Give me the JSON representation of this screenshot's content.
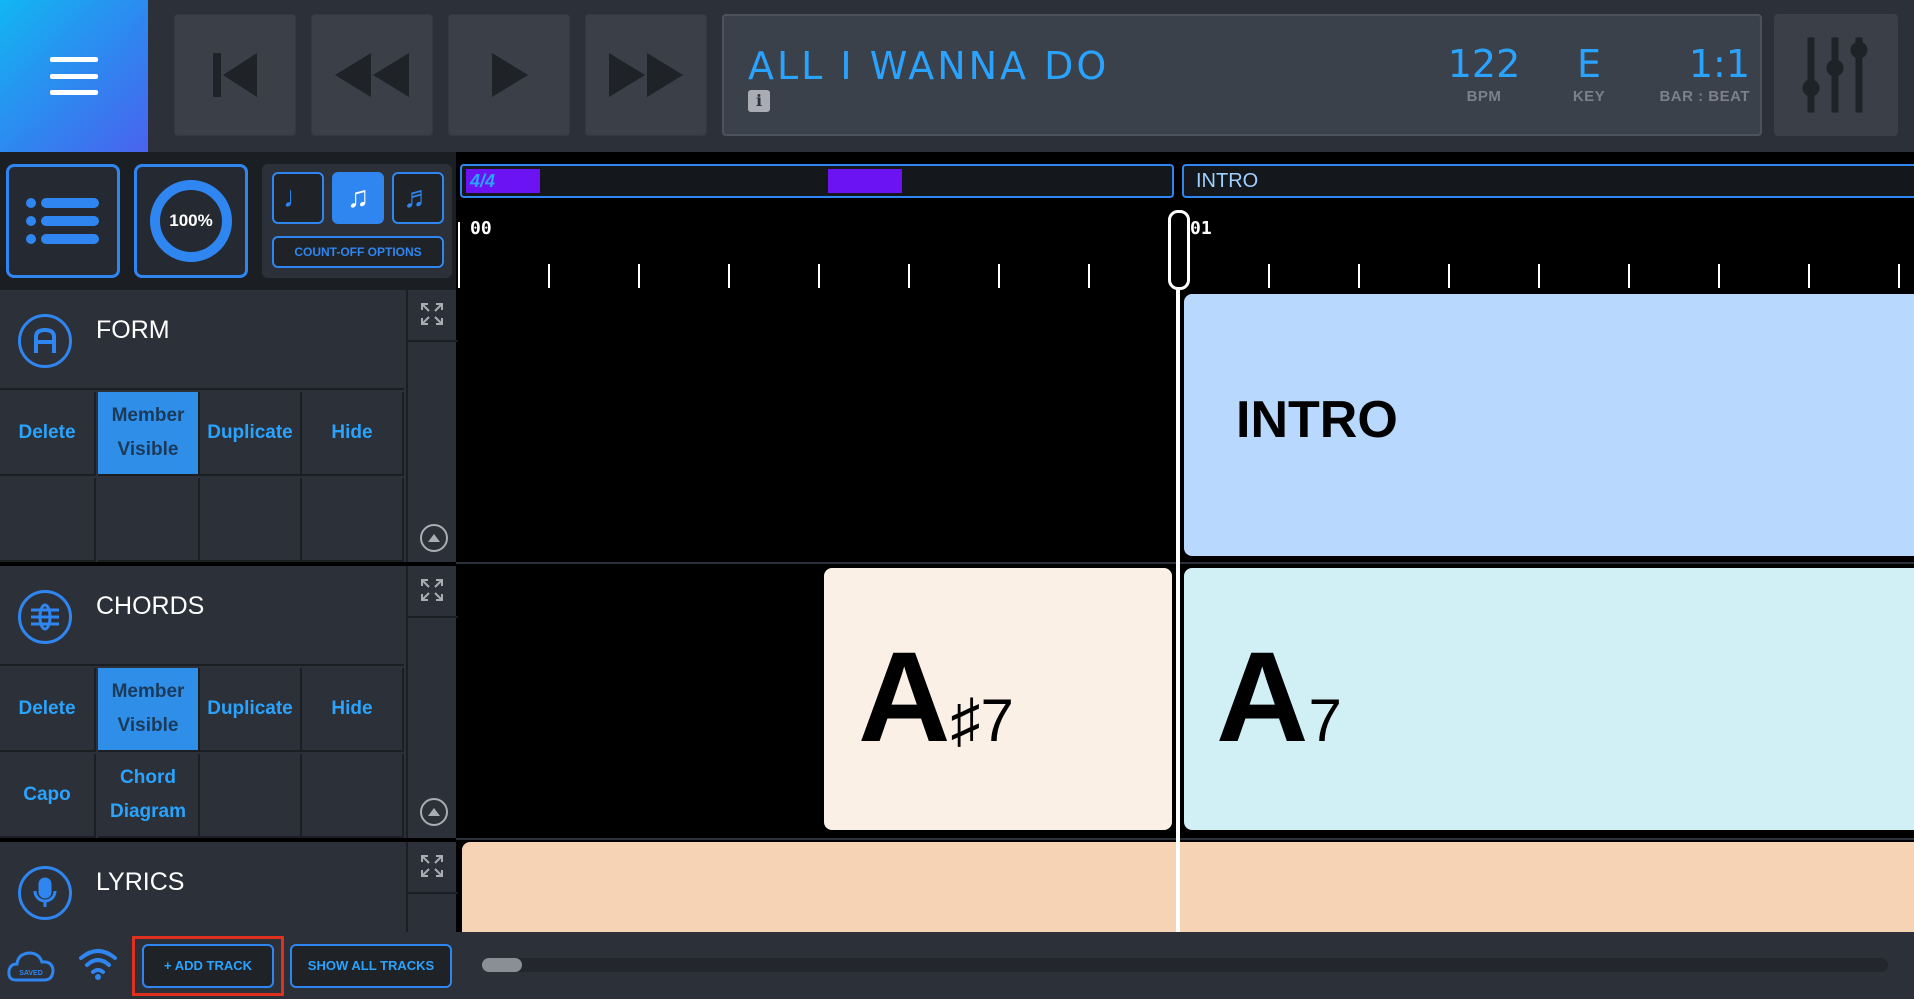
{
  "transport": {
    "song_title": "ALL I WANNA DO",
    "info_label": "i",
    "bpm_value": "122",
    "bpm_label": "BPM",
    "key_value": "E",
    "key_label": "KEY",
    "position_value": "1:1",
    "position_label": "BAR : BEAT"
  },
  "toolbar": {
    "zoom_label": "100%",
    "count_off_label": "COUNT-OFF OPTIONS",
    "note_buttons": [
      "♩",
      "♫",
      "♬"
    ]
  },
  "timeline": {
    "time_signature": "4/4",
    "section_label": "INTRO",
    "bar_labels": [
      "00",
      "01"
    ]
  },
  "tracks": {
    "form": {
      "name": "FORM",
      "actions": [
        "Delete",
        "Member Visible",
        "Duplicate",
        "Hide"
      ]
    },
    "chords": {
      "name": "CHORDS",
      "actions": [
        "Delete",
        "Member Visible",
        "Duplicate",
        "Hide"
      ],
      "extra_actions": [
        "Capo",
        "Chord Diagram"
      ]
    },
    "lyrics": {
      "name": "LYRICS"
    }
  },
  "clips": {
    "form_section": "INTRO",
    "chord_1_root": "A",
    "chord_1_ext": "♯7",
    "chord_2_root": "A",
    "chord_2_ext": "7"
  },
  "bottombar": {
    "cloud_status": "SAVED",
    "add_track_label": "+ ADD TRACK",
    "show_all_label": "SHOW ALL TRACKS"
  },
  "colors": {
    "accent": "#2f86f0",
    "text_blue": "#2aa3ff",
    "form_clip": "#b8d8fd",
    "chord_clip_1": "#faf0e6",
    "chord_clip_2": "#d0f0f6",
    "lyrics_clip": "#f6d3b4",
    "highlight": "#e0301e"
  }
}
